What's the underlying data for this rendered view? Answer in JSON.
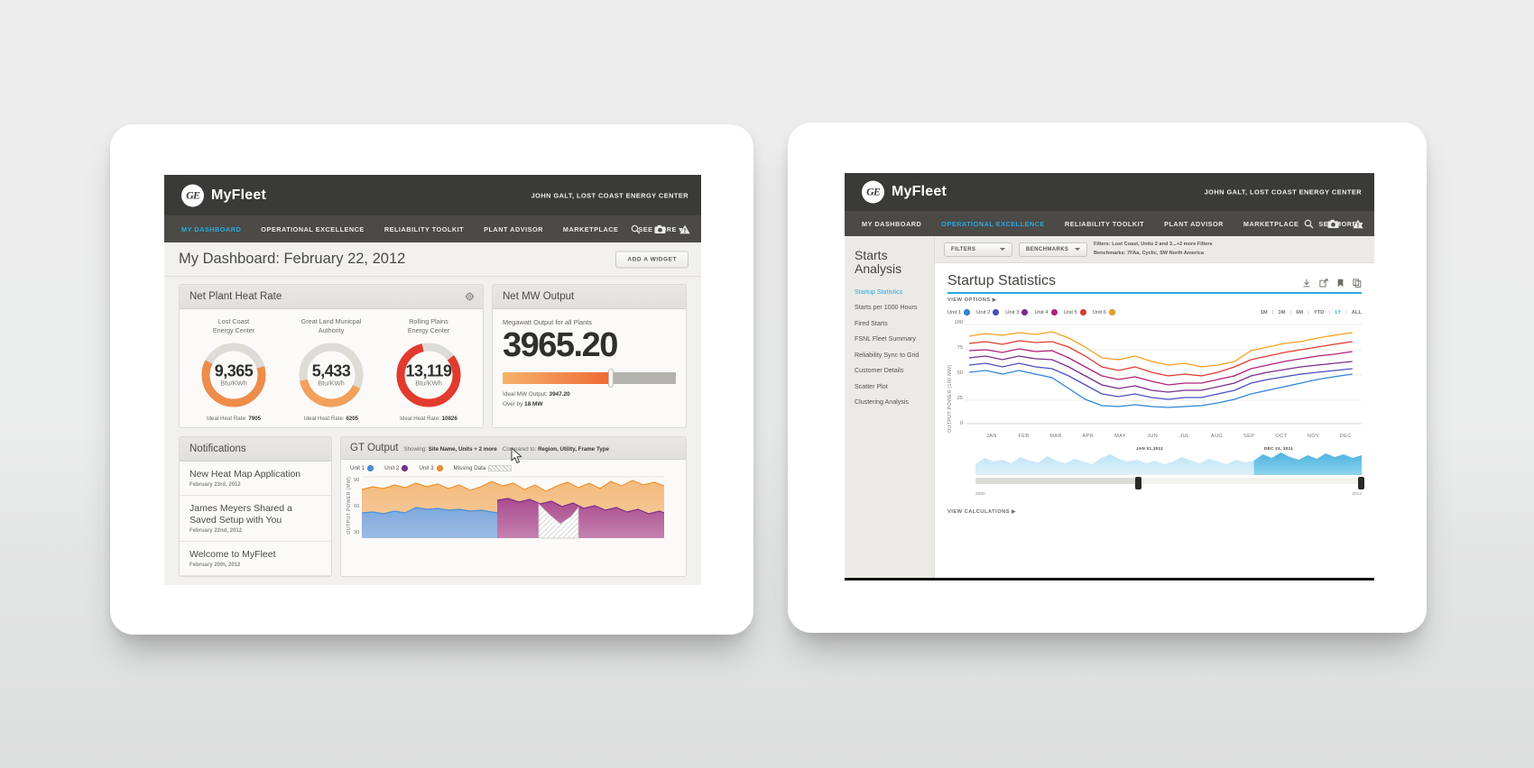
{
  "brand": {
    "name": "MyFleet",
    "logo_text": "GE"
  },
  "left_tablet": {
    "user": "JOHN GALT, LOST COAST ENERGY CENTER",
    "nav": [
      {
        "label": "MY DASHBOARD",
        "active": true
      },
      {
        "label": "OPERATIONAL EXCELLENCE",
        "active": false
      },
      {
        "label": "RELIABILITY TOOLKIT",
        "active": false
      },
      {
        "label": "PLANT ADVISOR",
        "active": false
      },
      {
        "label": "MARKETPLACE",
        "active": false
      },
      {
        "label": "SEE MORE",
        "active": false
      }
    ],
    "page_title": "My Dashboard: February 22, 2012",
    "add_widget_label": "ADD A WIDGET",
    "heat_rate": {
      "card_title": "Net Plant Heat Rate",
      "unit": "Btu/KWh",
      "ideal_prefix": "Ideal Heat Rate:",
      "gauges": [
        {
          "name": "Lost Coast\nEnergy Center",
          "value": "9,365",
          "ideal": "7905",
          "color": "#ee8c4a",
          "pct": 62
        },
        {
          "name": "Great Land Municpal\nAuthority",
          "value": "5,433",
          "ideal": "6205",
          "color": "#f2a05c",
          "pct": 50
        },
        {
          "name": "Rolling Plains\nEnergy Center",
          "value": "13,119",
          "ideal": "10826",
          "color": "#e23b2e",
          "pct": 82
        }
      ]
    },
    "mw_output": {
      "card_title": "Net MW Output",
      "subtitle": "Megawatt Output for all Plants",
      "value": "3965.20",
      "ideal_label": "Ideal MW Output:",
      "ideal_value": "3947.20",
      "over_label": "Over by",
      "over_value": "18 MW"
    },
    "notifications": {
      "card_title": "Notifications",
      "items": [
        {
          "title": "New Heat Map Application",
          "date": "February 23rd, 2012"
        },
        {
          "title": "James Meyers Shared a Saved Setup with You",
          "date": "February 22nd, 2012"
        },
        {
          "title": "Welcome to MyFleet",
          "date": "February 20th, 2012"
        }
      ]
    },
    "gt_output": {
      "card_title": "GT Output",
      "showing_label": "Showing:",
      "showing_value": "Site Name, Units + 2 more",
      "compared_label": "Compared to:",
      "compared_value": "Region, Utility, Frame Type",
      "legend": [
        {
          "label": "Unit 1",
          "color": "#4a90d9"
        },
        {
          "label": "Unit 2",
          "color": "#7b2d8e"
        },
        {
          "label": "Unit 3",
          "color": "#f0922b"
        }
      ],
      "missing_label": "Missing Data",
      "ylabel": "OUTPUT POWER (MW)",
      "yticks": [
        "90",
        "60",
        "30"
      ]
    }
  },
  "right_tablet": {
    "user": "JOHN GALT, LOST COAST ENERGY CENTER",
    "nav": [
      {
        "label": "MY DASHBOARD",
        "active": false
      },
      {
        "label": "OPERATIONAL EXCELLENCE",
        "active": true
      },
      {
        "label": "RELIABILITY TOOLKIT",
        "active": false
      },
      {
        "label": "PLANT ADVISOR",
        "active": false
      },
      {
        "label": "MARKETPLACE",
        "active": false
      },
      {
        "label": "SEE MORE",
        "active": false
      }
    ],
    "sidebar": {
      "heading": "Starts\nAnalysis",
      "items": [
        {
          "label": "Startup Statistics",
          "active": true
        },
        {
          "label": "Starts per 1000 Hours",
          "active": false
        },
        {
          "label": "Fired Starts",
          "active": false
        },
        {
          "label": "FSNL Fleet Summary",
          "active": false
        },
        {
          "label": "Reliability Sync to Grid",
          "active": false
        },
        {
          "label": "Customer Details",
          "active": false
        },
        {
          "label": "Scatter Plot",
          "active": false
        },
        {
          "label": "Clustering Analysis",
          "active": false
        }
      ]
    },
    "filters": {
      "filters_label": "FILTERS",
      "benchmarks_label": "BENCHMARKS",
      "filters_summary": "Filters: Lost Coast, Units 2 and 3...+2 more Filters",
      "benchmarks_summary": "Benchmarks: 7FAa, Cyclic, SW North America"
    },
    "chart_panel": {
      "title": "Startup Statistics",
      "view_options": "VIEW OPTIONS ▶",
      "view_calculations": "VIEW CALCULATIONS ▶",
      "ranges": [
        {
          "label": "1M",
          "active": false
        },
        {
          "label": "3M",
          "active": false
        },
        {
          "label": "6M",
          "active": false
        },
        {
          "label": "YTD",
          "active": false
        },
        {
          "label": "1Y",
          "active": true
        },
        {
          "label": "ALL",
          "active": false
        }
      ],
      "brush": {
        "left_label": "JAN 01,2011",
        "right_label": "DEC 31, 2011",
        "start_year": "2000",
        "end_year": "2012"
      }
    }
  },
  "chart_data": {
    "type": "line",
    "title": "Startup Statistics",
    "xlabel": "",
    "ylabel": "OUTPUT POWER (100 MW)",
    "categories": [
      "JAN",
      "FEB",
      "MAR",
      "APR",
      "MAY",
      "JUN",
      "JUL",
      "AUG",
      "SEP",
      "OCT",
      "NOV",
      "DEC"
    ],
    "yticks": [
      0,
      25,
      50,
      75,
      100
    ],
    "ylim": [
      0,
      100
    ],
    "grid": false,
    "legend_position": "top-left",
    "series": [
      {
        "name": "Unit 1",
        "color": "#2f86d8",
        "values": [
          62,
          64,
          60,
          40,
          26,
          27,
          25,
          24,
          27,
          30,
          33,
          36
        ]
      },
      {
        "name": "Unit 2",
        "color": "#4a4ec4",
        "values": [
          68,
          70,
          66,
          48,
          34,
          33,
          31,
          30,
          35,
          40,
          44,
          47
        ]
      },
      {
        "name": "Unit 3",
        "color": "#7b2d8e",
        "values": [
          74,
          76,
          72,
          57,
          42,
          41,
          40,
          38,
          44,
          50,
          54,
          57
        ]
      },
      {
        "name": "Unit 4",
        "color": "#b1217a",
        "values": [
          80,
          82,
          78,
          66,
          50,
          49,
          47,
          45,
          52,
          58,
          63,
          66
        ]
      },
      {
        "name": "Unit 5",
        "color": "#e03a2f",
        "values": [
          86,
          88,
          84,
          74,
          58,
          56,
          55,
          53,
          61,
          67,
          71,
          75
        ]
      },
      {
        "name": "Unit 6",
        "color": "#f5a01f",
        "values": [
          92,
          94,
          90,
          82,
          66,
          64,
          62,
          60,
          70,
          76,
          80,
          84
        ]
      }
    ]
  },
  "gt_chart_data": {
    "type": "area",
    "title": "GT Output",
    "ylabel": "OUTPUT POWER (MW)",
    "yticks": [
      30,
      60,
      90
    ],
    "ylim": [
      0,
      100
    ],
    "series": [
      {
        "name": "Unit 1",
        "color": "#4a90d9",
        "values": [
          38,
          40,
          39,
          41,
          43,
          42,
          44,
          43,
          45,
          44,
          43,
          42,
          41,
          42,
          40,
          39,
          38,
          37,
          36,
          35,
          34,
          33,
          32,
          31,
          30,
          29,
          28,
          27,
          26,
          25
        ]
      },
      {
        "name": "Unit 2",
        "color": "#7b2d8e",
        "values": [
          0,
          0,
          0,
          0,
          0,
          0,
          0,
          0,
          0,
          0,
          0,
          0,
          0,
          58,
          60,
          59,
          57,
          55,
          54,
          52,
          50,
          48,
          46,
          44,
          42,
          40,
          38,
          36,
          34,
          32
        ]
      },
      {
        "name": "Unit 3",
        "color": "#f0922b",
        "values": [
          78,
          80,
          79,
          81,
          83,
          82,
          84,
          83,
          85,
          84,
          80,
          78,
          82,
          86,
          84,
          82,
          80,
          78,
          79,
          81,
          83,
          85,
          84,
          86,
          88,
          87,
          89,
          90,
          88,
          86
        ]
      }
    ],
    "missing_data_region": [
      18,
      23
    ]
  }
}
